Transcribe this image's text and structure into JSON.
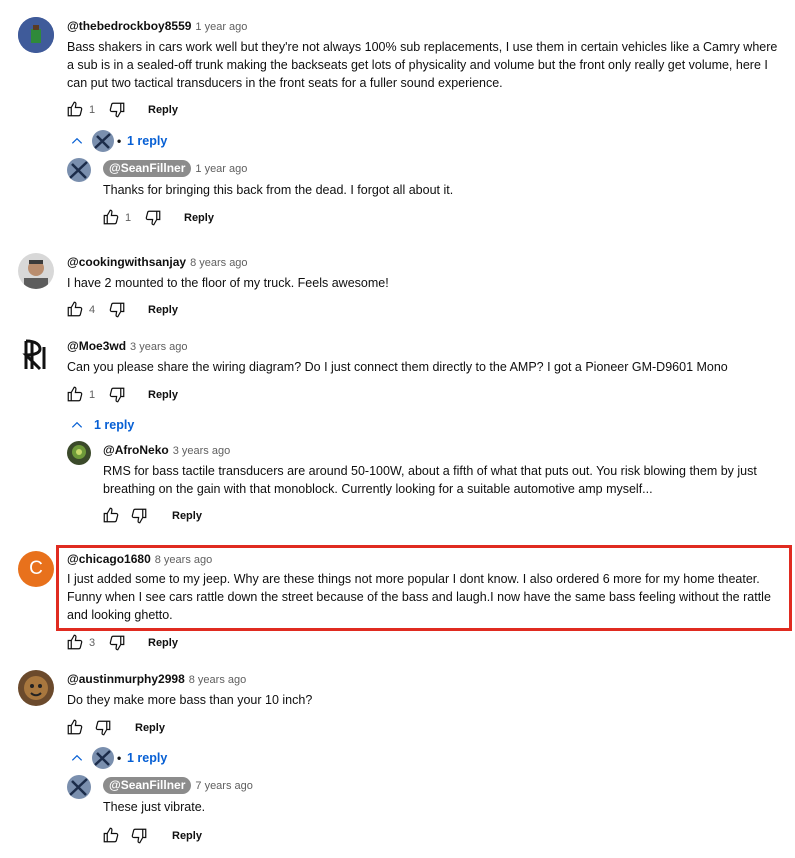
{
  "comments": [
    {
      "author": "@thebedrockboy8559",
      "time": "1 year ago",
      "lines": [
        "Bass shakers in cars work well but they're not always 100% sub replacements, I use them in certain vehicles like a Camry where",
        "a sub is in a sealed-off trunk making the backseats get lots of physicality and volume but the front only really get volume, here I",
        "can put two tactical transducers in the front seats for a fuller sound experience."
      ],
      "likes": "1",
      "reply_label": "Reply",
      "replies_toggle": "1 reply",
      "reply": {
        "author": "@SeanFillner",
        "time": "1 year ago",
        "lines": [
          "Thanks for bringing this back from the dead.  I forgot all about it."
        ],
        "likes": "1",
        "reply_label": "Reply"
      }
    },
    {
      "author": "@cookingwithsanjay",
      "time": "8 years ago",
      "lines": [
        "I have 2 mounted to the floor of my truck. Feels awesome!"
      ],
      "likes": "4",
      "reply_label": "Reply"
    },
    {
      "author": "@Moe3wd",
      "time": "3 years ago",
      "lines": [
        "Can you please share the wiring diagram? Do I just connect them directly to the AMP? I got a Pioneer GM-D9601 Mono"
      ],
      "likes": "1",
      "reply_label": "Reply",
      "replies_toggle": "1 reply",
      "reply": {
        "author": "@AfroNeko",
        "time": "3 years ago",
        "lines": [
          "RMS for bass tactile transducers are around 50-100W, about a fifth of what that puts out. You risk blowing them by just",
          "breathing on the gain with that monoblock. Currently looking for a suitable automotive amp myself..."
        ],
        "reply_label": "Reply"
      }
    },
    {
      "author": "@chicago1680",
      "time": "8 years ago",
      "avatar_letter": "C",
      "lines": [
        "I just added some to my jeep. Why are these things not more popular I dont know. I also ordered 6 more for my home theater.",
        "Funny when I see cars rattle down the street because of the bass and laugh.I now have the same bass  feeling without the rattle",
        "and looking ghetto."
      ],
      "likes": "3",
      "reply_label": "Reply"
    },
    {
      "author": "@austinmurphy2998",
      "time": "8 years ago",
      "lines": [
        "Do they make more bass than your 10 inch?"
      ],
      "reply_label": "Reply",
      "replies_toggle": "1 reply",
      "reply": {
        "author": "@SeanFillner",
        "time": "7 years ago",
        "lines": [
          "These just vibrate."
        ],
        "reply_label": "Reply"
      }
    }
  ],
  "colors": {
    "highlight": "#e02b20",
    "link_blue": "#065fd4",
    "chicago_avatar": "#e8711c",
    "creator_pill": "#8c8c8c"
  }
}
